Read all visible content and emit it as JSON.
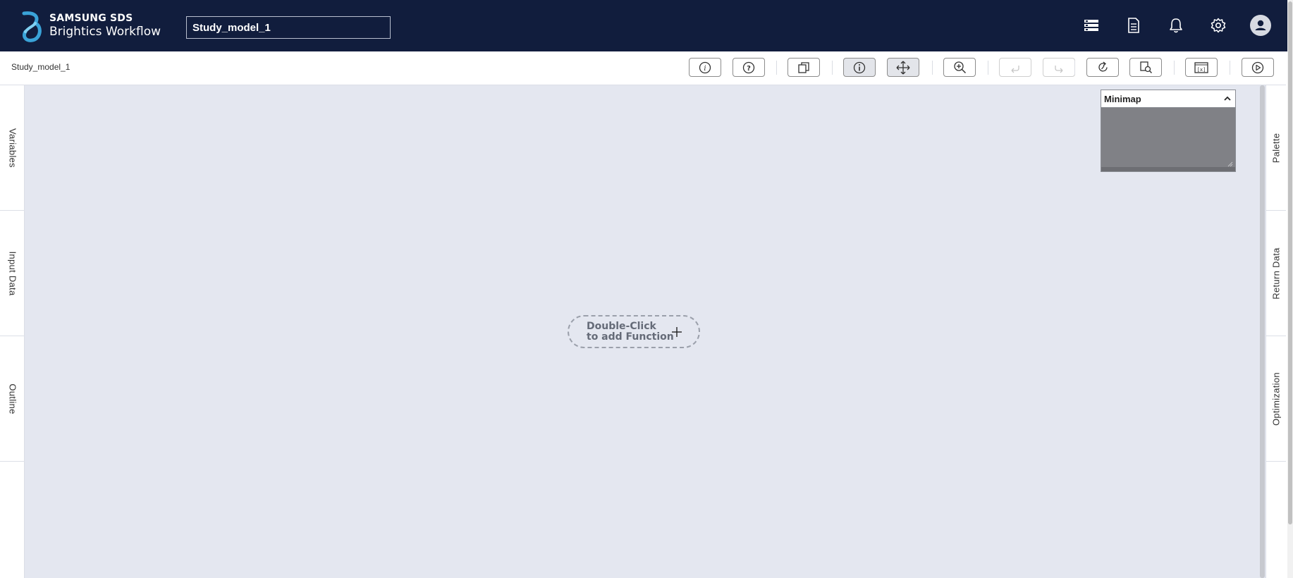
{
  "header": {
    "brand_line1": "SAMSUNG SDS",
    "brand_line2": "Brightics Workflow",
    "model_name_value": "Study_model_1",
    "icons": [
      "database-icon",
      "document-icon",
      "bell-icon",
      "gear-icon",
      "user-avatar-icon"
    ]
  },
  "toolbar": {
    "breadcrumb": "Study_model_1",
    "buttons": [
      "info-icon",
      "help-icon",
      "copy-icon",
      "info-active-icon",
      "move-icon",
      "zoom-in-icon",
      "undo-icon",
      "redo-icon",
      "refresh-icon",
      "search-document-icon",
      "variable-icon",
      "run-icon"
    ]
  },
  "left_panel": {
    "tabs": [
      "Variables",
      "Input Data",
      "Outline"
    ]
  },
  "right_panel": {
    "tabs": [
      "Palette",
      "Return Data",
      "Optimization"
    ]
  },
  "canvas": {
    "add_function_line1": "Double-Click",
    "add_function_line2": "to add Function"
  },
  "minimap": {
    "title": "Minimap"
  },
  "colors": {
    "header_bg": "#111d3d",
    "canvas_bg": "#e4e7f0",
    "logo_accent": "#3aa3d8"
  }
}
